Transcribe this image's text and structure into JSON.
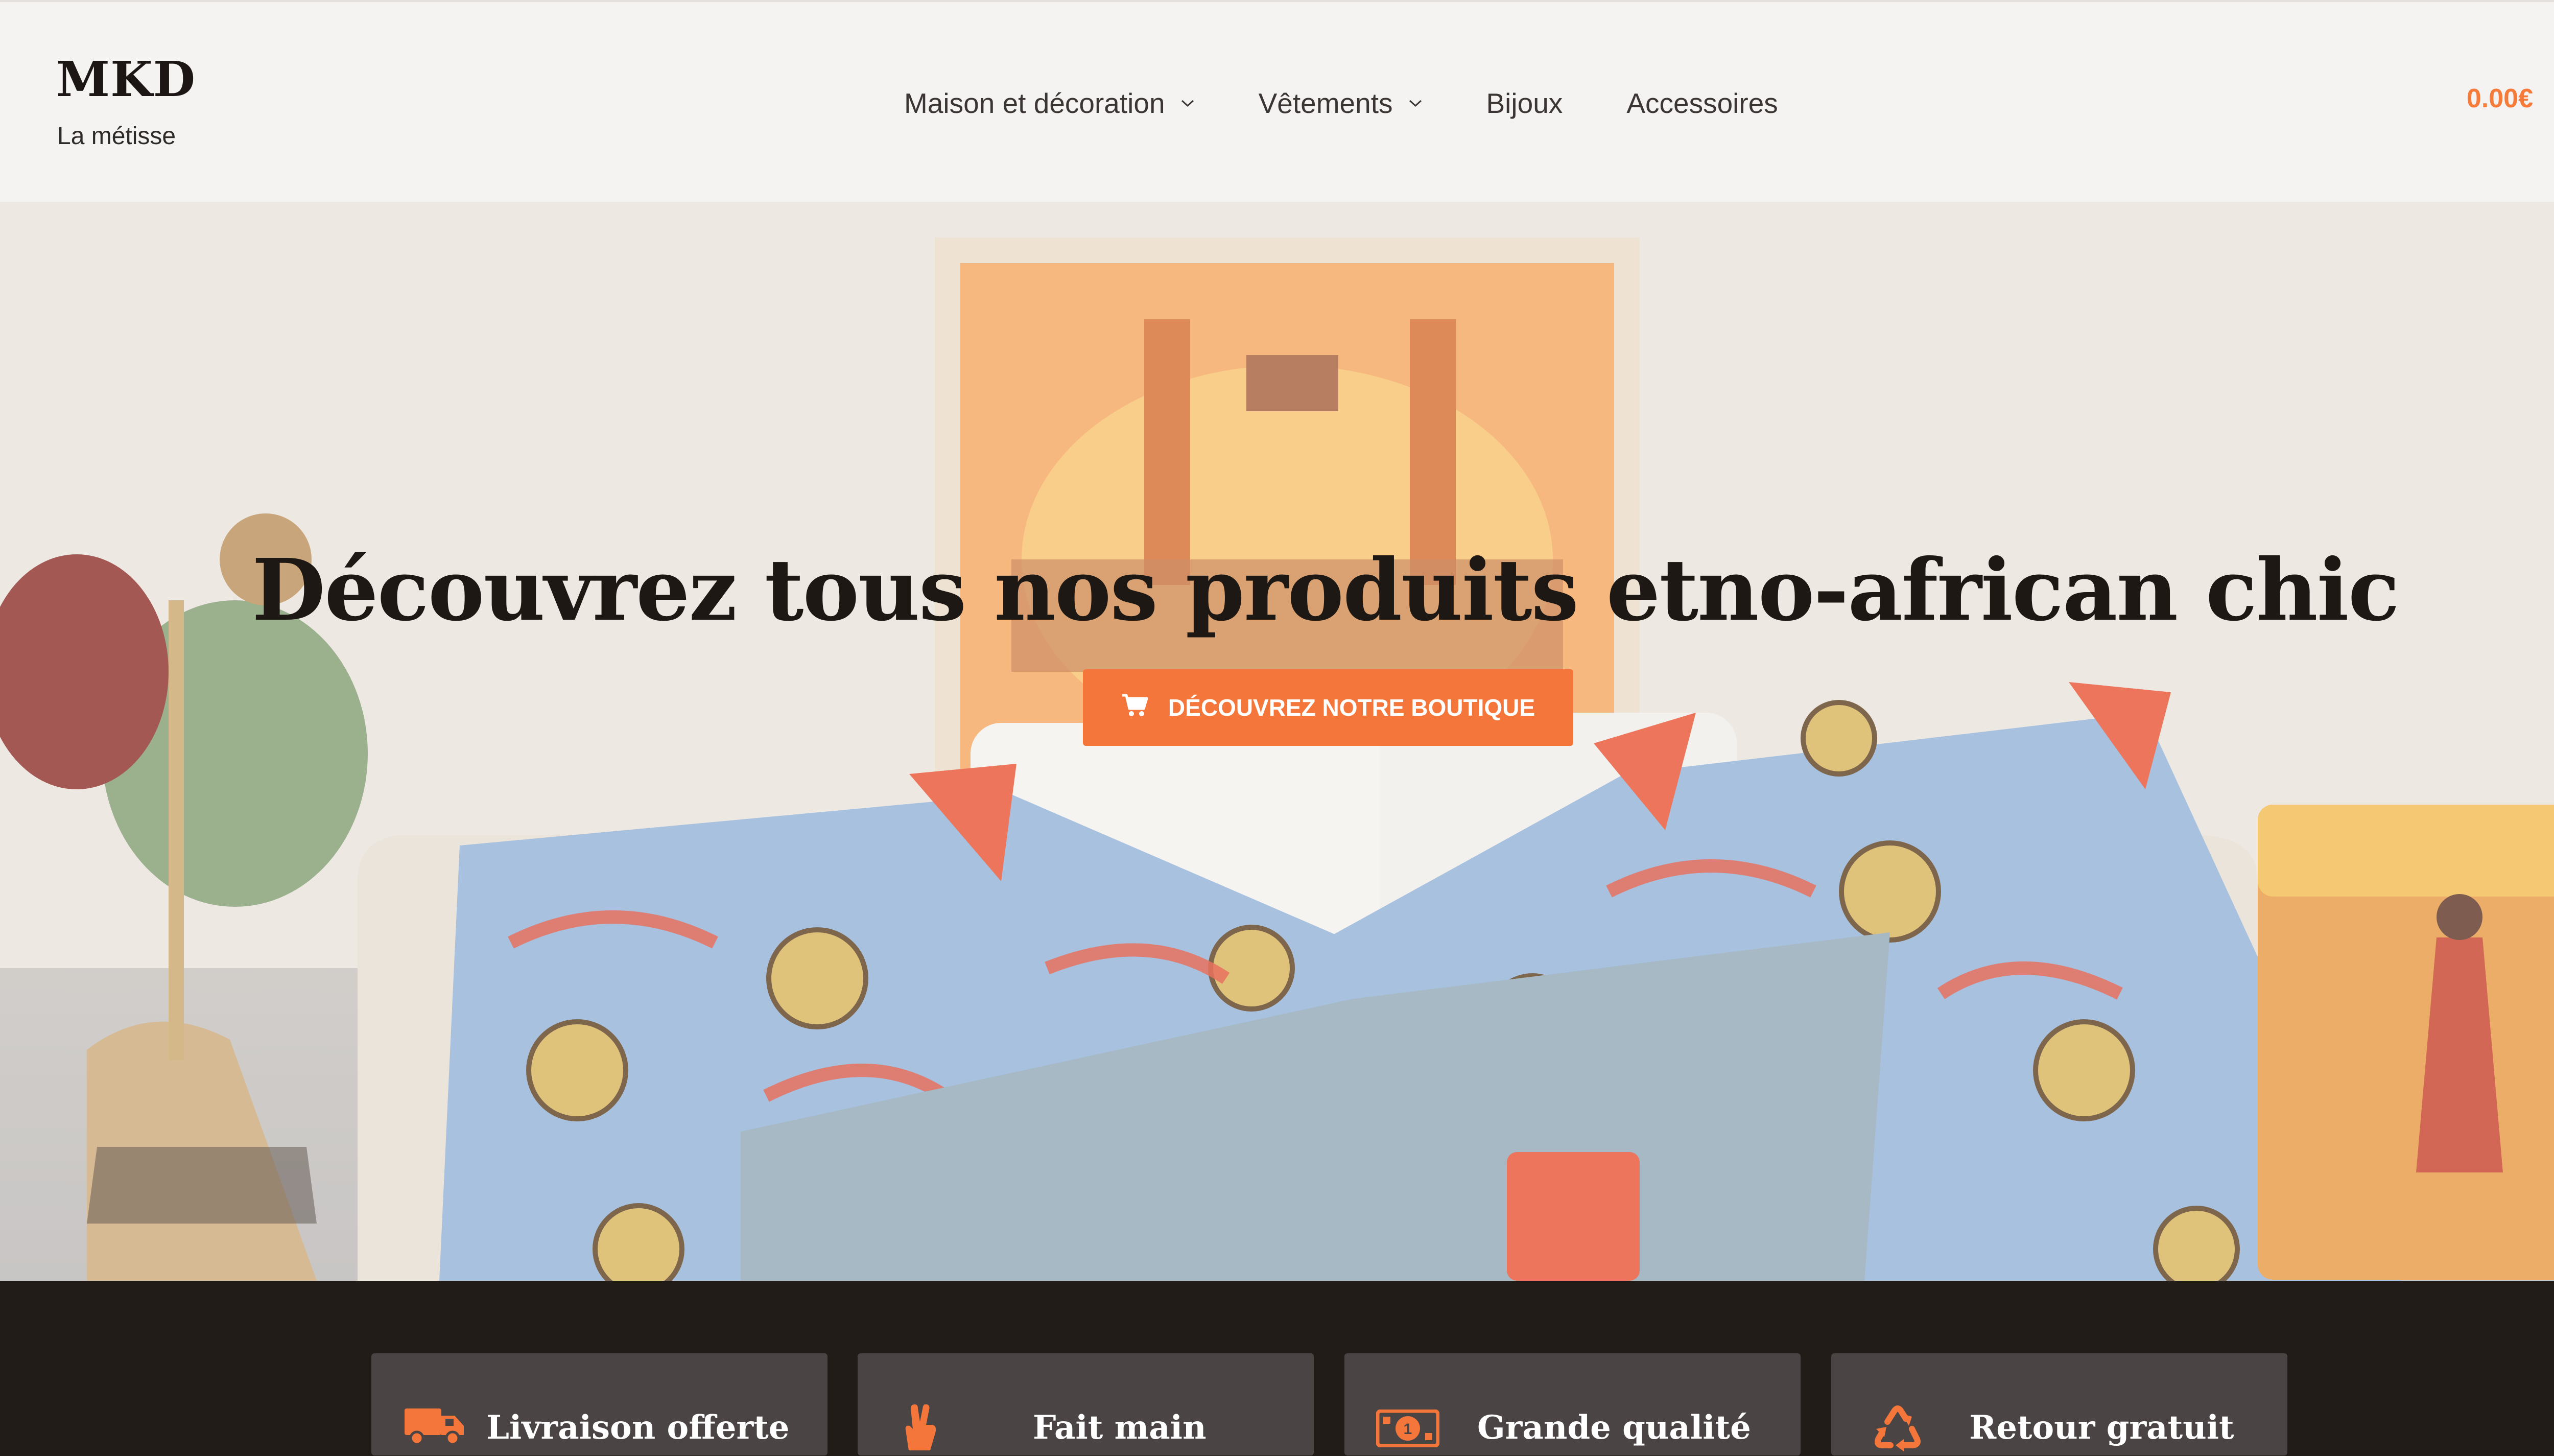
{
  "header": {
    "brand_title": "MKD",
    "brand_tagline": "La métisse",
    "nav": [
      {
        "label": "Maison et décoration",
        "has_dropdown": true
      },
      {
        "label": "Vêtements",
        "has_dropdown": true
      },
      {
        "label": "Bijoux",
        "has_dropdown": false
      },
      {
        "label": "Accessoires",
        "has_dropdown": false
      }
    ],
    "cart": {
      "total": "0.00€",
      "count": "0"
    }
  },
  "hero": {
    "heading": "Découvrez tous nos produits etno-african chic",
    "cta_label": "DÉCOUVREZ NOTRE BOUTIQUE",
    "cta_icon": "shopping-cart-icon"
  },
  "features": [
    {
      "title": "Livraison offerte",
      "icon": "truck-icon"
    },
    {
      "title": "Fait main",
      "icon": "hand-icon"
    },
    {
      "title": "Grande qualité",
      "icon": "money-icon"
    },
    {
      "title": "Retour gratuit",
      "icon": "recycle-icon"
    }
  ],
  "colors": {
    "accent": "#f5763a",
    "header_bg": "#f5f3f2",
    "dark_band": "#211c18",
    "feature_card": "#4a4544"
  }
}
